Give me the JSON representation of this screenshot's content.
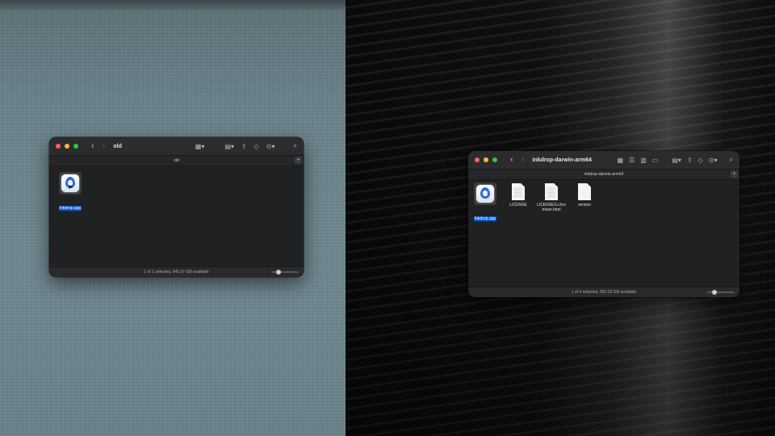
{
  "left_window": {
    "title": "old",
    "path": "old",
    "status": "1 of 1 selected, 645.97 GB available",
    "items": [
      {
        "label": "Inkdrop.app",
        "kind": "app",
        "selected": true
      }
    ]
  },
  "right_window": {
    "title": "inkdrop-darwin-arm64",
    "path": "inkdrop-darwin-arm64",
    "status": "1 of 4 selected, 681.03 GB available",
    "items": [
      {
        "label": "Inkdrop.app",
        "kind": "app",
        "selected": true
      },
      {
        "label": "LICENSE",
        "kind": "doc",
        "selected": false
      },
      {
        "label": "LICENSES.chromium.html",
        "kind": "doc",
        "selected": false
      },
      {
        "label": "version",
        "kind": "doc",
        "selected": false
      }
    ]
  },
  "icons": {
    "back": "‹",
    "forward": "›",
    "add": "+"
  }
}
